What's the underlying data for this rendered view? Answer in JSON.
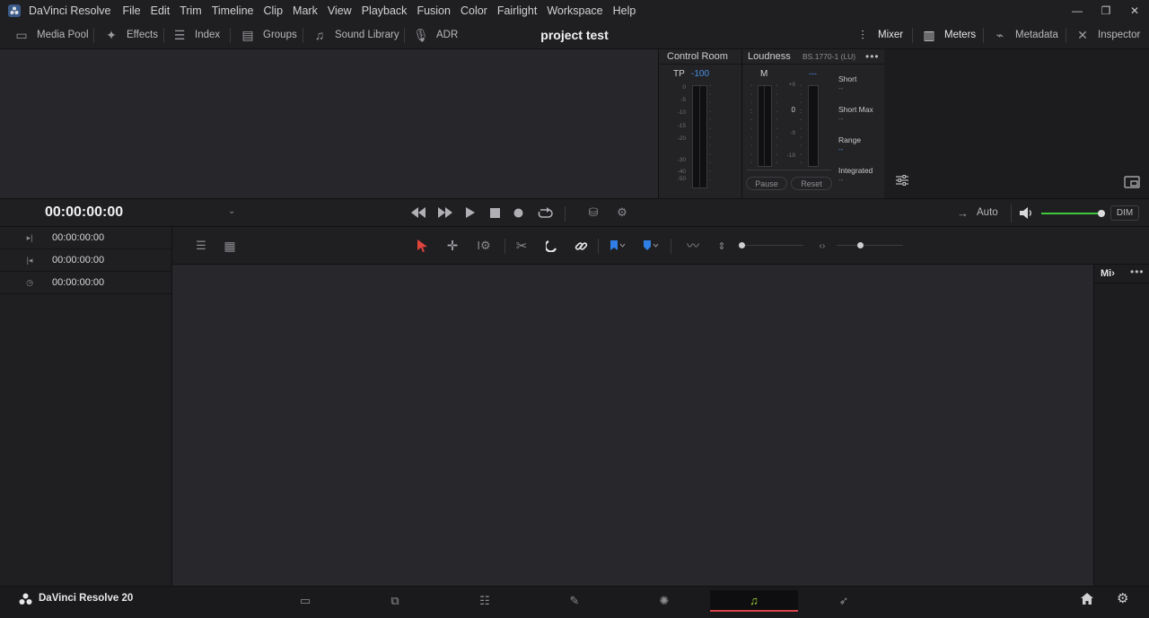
{
  "menubar": {
    "app_title": "DaVinci Resolve",
    "items": [
      "File",
      "Edit",
      "Trim",
      "Timeline",
      "Clip",
      "Mark",
      "View",
      "Playback",
      "Fusion",
      "Color",
      "Fairlight",
      "Workspace",
      "Help"
    ],
    "window_controls": [
      "—",
      "❐",
      "✕"
    ]
  },
  "toolbar": {
    "project_title": "project test",
    "left": [
      {
        "label": "Media Pool",
        "icon": "media-pool-icon"
      },
      {
        "label": "Effects",
        "icon": "effects-wand-icon"
      },
      {
        "label": "Index",
        "icon": "index-list-icon"
      },
      {
        "label": "Groups",
        "icon": "groups-icon"
      },
      {
        "label": "Sound Library",
        "icon": "sound-library-icon"
      },
      {
        "label": "ADR",
        "icon": "microphone-icon"
      }
    ],
    "right": [
      {
        "label": "Mixer",
        "icon": "mixer-sliders-icon"
      },
      {
        "label": "Meters",
        "icon": "meters-bars-icon"
      },
      {
        "label": "Metadata",
        "icon": "metadata-tag-icon"
      },
      {
        "label": "Inspector",
        "icon": "inspector-tools-icon"
      }
    ]
  },
  "control_room": {
    "title": "Control Room",
    "tp_label": "TP",
    "tp_value": "-100",
    "scale": [
      "0",
      "-5",
      "-10",
      "-15",
      "-20",
      "-30",
      "-40",
      "-50"
    ]
  },
  "loudness": {
    "title": "Loudness",
    "standard": "BS.1770-1 (LU)",
    "m_label": "M",
    "m_value": "---",
    "scale": [
      "+9",
      "0",
      "-9",
      "-18"
    ],
    "stats": [
      {
        "label": "Short",
        "value": "--"
      },
      {
        "label": "Short Max",
        "value": "--"
      },
      {
        "label": "Range",
        "value": "--"
      },
      {
        "label": "Integrated",
        "value": "--"
      }
    ],
    "pause_label": "Pause",
    "reset_label": "Reset"
  },
  "transport": {
    "timecode": "00:00:00:00",
    "auto_label": "Auto",
    "dim_label": "DIM",
    "volume_level": 1.0
  },
  "timecodes": [
    {
      "icon": "play-from-icon",
      "value": "00:00:00:00"
    },
    {
      "icon": "play-to-icon",
      "value": "00:00:00:00"
    },
    {
      "icon": "clock-icon",
      "value": "00:00:00:00"
    }
  ],
  "mixer_panel": {
    "title": "Mi›"
  },
  "pagebar": {
    "app_name": "DaVinci Resolve 20",
    "pages": [
      "Media",
      "Cut",
      "Edit",
      "Fusion",
      "Color",
      "Fairlight",
      "Deliver"
    ],
    "active_page": "Fairlight"
  },
  "colors": {
    "accent_blue": "#4a8fe0",
    "active_green": "#9fd43a",
    "active_red": "#d8434c",
    "volume_green": "#3ec93e"
  }
}
